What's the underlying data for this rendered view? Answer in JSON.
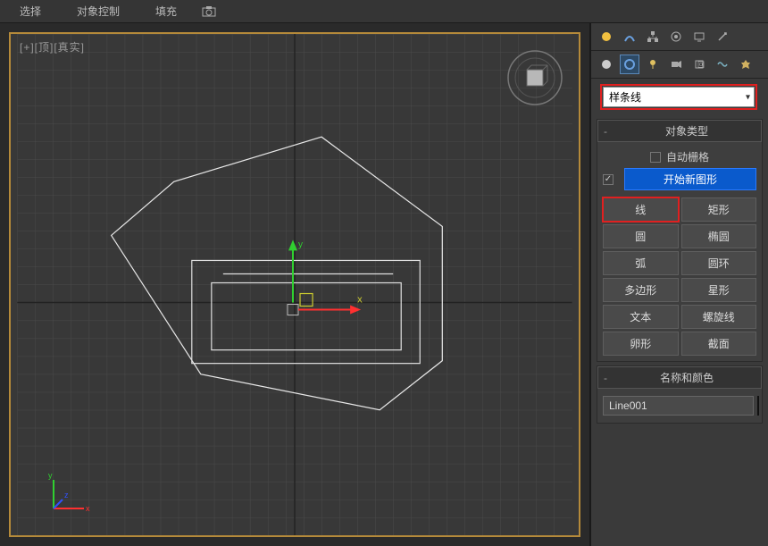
{
  "menubar": {
    "items": [
      "选择",
      "对象控制",
      "填充"
    ],
    "toolbar_icon": "snapshot-icon"
  },
  "viewport": {
    "label": "[+][顶][真实]",
    "axis_labels": {
      "x": "x",
      "y": "y",
      "z": "z"
    }
  },
  "right_panel": {
    "category_dropdown": "样条线",
    "rollout_object_type": {
      "title": "对象类型",
      "auto_grid_label": "自动栅格",
      "start_new_shape_label": "开始新图形",
      "start_new_shape_checked": true,
      "shape_buttons": [
        {
          "label": "线",
          "highlight": true
        },
        {
          "label": "矩形"
        },
        {
          "label": "圆"
        },
        {
          "label": "椭圆"
        },
        {
          "label": "弧"
        },
        {
          "label": "圆环"
        },
        {
          "label": "多边形"
        },
        {
          "label": "星形"
        },
        {
          "label": "文本"
        },
        {
          "label": "螺旋线"
        },
        {
          "label": "卵形"
        },
        {
          "label": "截面"
        }
      ]
    },
    "rollout_name_color": {
      "title": "名称和颜色",
      "object_name": "Line001",
      "swatch_color": "#2050ff"
    }
  },
  "colors": {
    "axis_x": "#ff3030",
    "axis_y": "#30d030",
    "axis_z": "#3050ff"
  }
}
